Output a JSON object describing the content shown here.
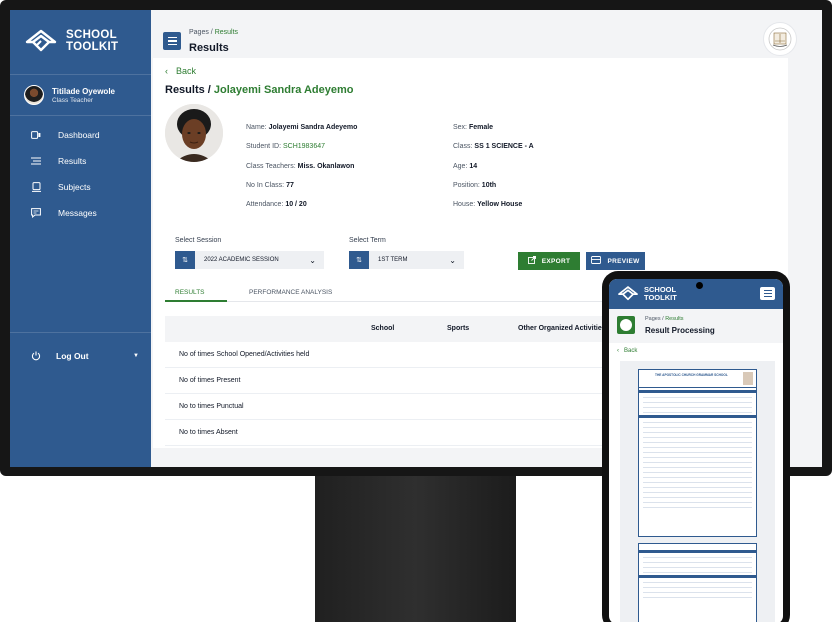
{
  "brand": {
    "line1": "SCHOOL",
    "line2": "TOOLKIT"
  },
  "user": {
    "name": "Titilade Oyewole",
    "role": "Class Teacher"
  },
  "sidebar": {
    "items": [
      {
        "label": "Dashboard",
        "icon": "dashboard-icon"
      },
      {
        "label": "Results",
        "icon": "results-icon"
      },
      {
        "label": "Subjects",
        "icon": "subjects-icon"
      },
      {
        "label": "Messages",
        "icon": "messages-icon"
      }
    ],
    "logout_label": "Log Out"
  },
  "header": {
    "breadcrumb_parent": "Pages",
    "breadcrumb_sep": " / ",
    "breadcrumb_current": "Results",
    "title": "Results"
  },
  "result": {
    "back_label": "Back",
    "title_prefix": "Results / ",
    "student_name": "Jolayemi Sandra Adeyemo",
    "fields_left": [
      {
        "label": "Name: ",
        "value": "Jolayemi Sandra Adeyemo"
      },
      {
        "label": "Student ID: ",
        "value": "SCH1983647"
      },
      {
        "label": "Class Teachers: ",
        "value": "Miss. Okanlawon"
      },
      {
        "label": "No In Class: ",
        "value": "77"
      },
      {
        "label": "Attendance: ",
        "value": "10 / 20"
      }
    ],
    "fields_right": [
      {
        "label": "Sex: ",
        "value": "Female"
      },
      {
        "label": "Class: ",
        "value": "SS 1 SCIENCE - A"
      },
      {
        "label": "Age: ",
        "value": "14"
      },
      {
        "label": "Position: ",
        "value": "10th"
      },
      {
        "label": "House: ",
        "value": "Yellow House"
      }
    ]
  },
  "filters": {
    "session_label": "Select Session",
    "session_value": "2022 ACADEMIC SESSION",
    "term_label": "Select Term",
    "term_value": "1ST TERM",
    "export_label": "EXPORT",
    "preview_label": "PREVIEW"
  },
  "tabs": {
    "results": "RESULTS",
    "performance": "PERFORMANCE ANALYSIS"
  },
  "table": {
    "columns": [
      "School",
      "Sports",
      "Other Organized Activities"
    ],
    "rows": [
      "No of times School Opened/Activities held",
      "No of times Present",
      "No to times Punctual",
      "No to times Absent"
    ]
  },
  "phone": {
    "brand_line1": "SCHOOL",
    "brand_line2": "TOOLKIT",
    "breadcrumb_parent": "Pages",
    "breadcrumb_sep": " / ",
    "breadcrumb_current": "Results",
    "title": "Result Processing",
    "back_label": "Back",
    "sheet_title": "THE APOSTOLIC CHURCH GRAMMAR SCHOOL"
  },
  "colors": {
    "primary": "#2f5a8f",
    "accent": "#2e7d32",
    "background": "#f3f4f6"
  }
}
